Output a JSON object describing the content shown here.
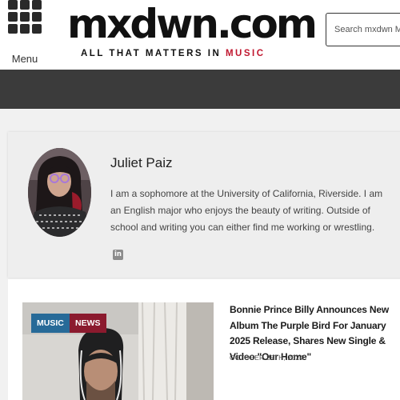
{
  "header": {
    "menu_label": "Menu",
    "logo_text": "mxdwn.com",
    "tagline_prefix": "ALL THAT MATTERS IN ",
    "tagline_accent": "MUSIC",
    "search_placeholder": "Search mxdwn Music"
  },
  "author": {
    "name": "Juliet Paiz",
    "bio": "I am a sophomore at the University of California, Riverside. I am an English major who enjoys the beauty of writing. Outside of school and writing you can either find me working or wrestling.",
    "social_icon": "linkedin-icon",
    "social_glyph": "in"
  },
  "article": {
    "badges": [
      "MUSIC",
      "NEWS"
    ],
    "title": "Bonnie Prince Billy Announces New Album The Purple Bird For January 2025 Release, Shares New Single & Video \"Our Home\"",
    "date": "OCTOBER 28TH, 2024"
  },
  "colors": {
    "accent": "#c0172f",
    "navbar": "#3b3b3b",
    "badge_music": "#276a98",
    "badge_news": "#8b1a2e"
  }
}
